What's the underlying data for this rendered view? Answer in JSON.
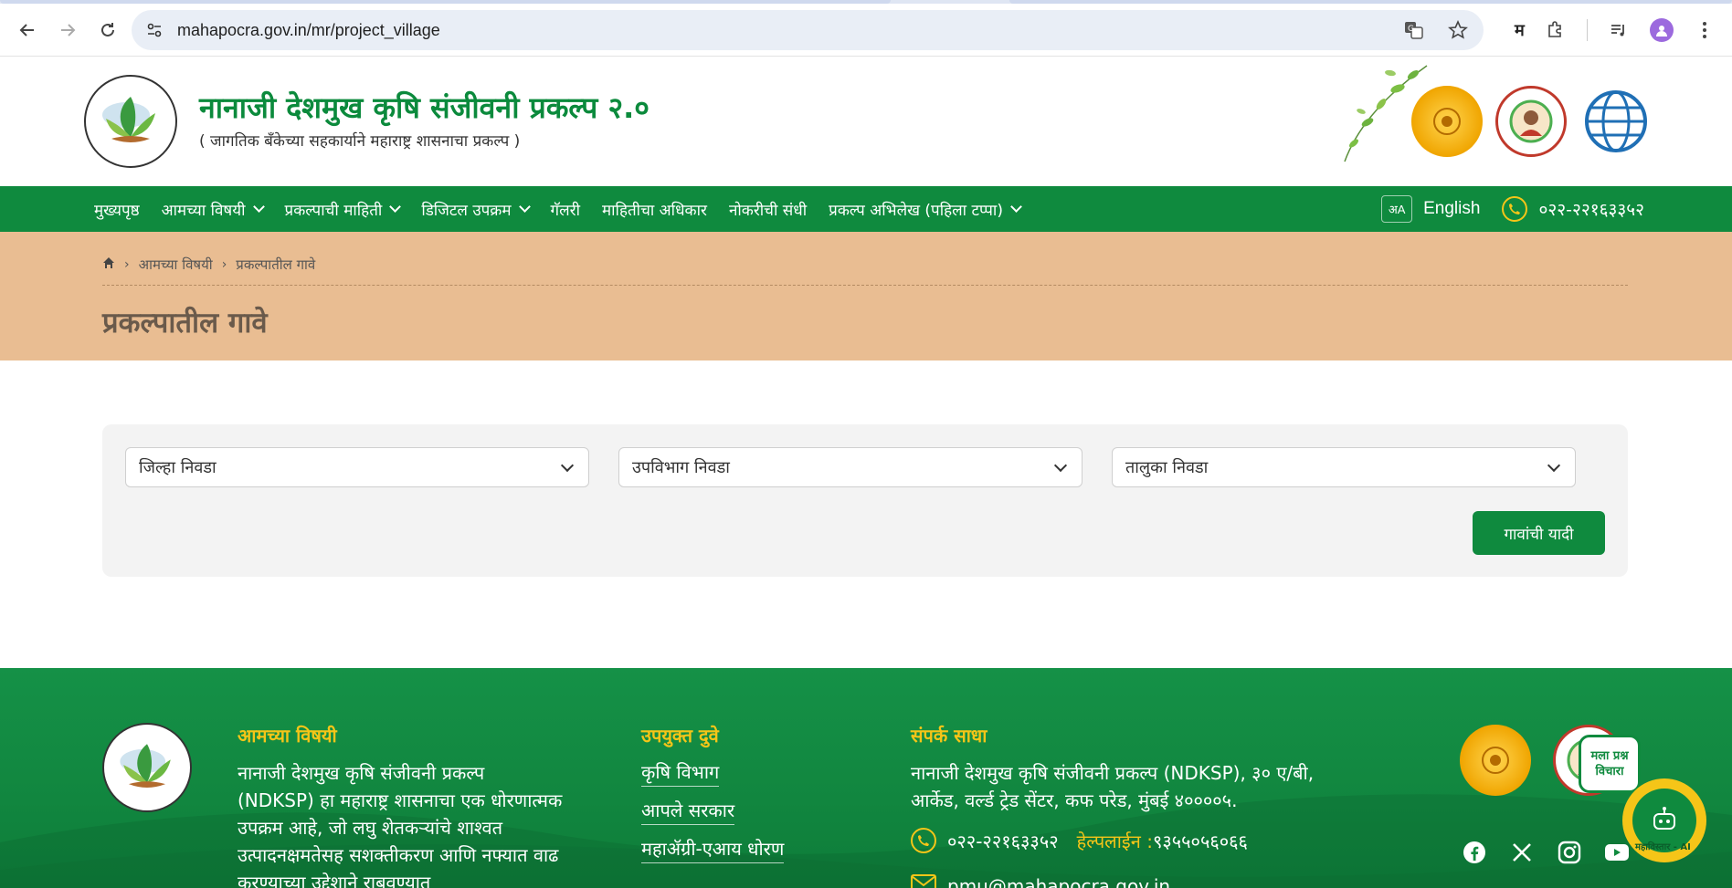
{
  "browser": {
    "url": "mahapocra.gov.in/mr/project_village",
    "profile_letter": "म"
  },
  "header": {
    "title": "नानाजी देशमुख कृषि संजीवनी प्रकल्प २.०",
    "subtitle": "( जागतिक बँकेच्या सहकार्याने महाराष्ट्र शासनाचा प्रकल्प )"
  },
  "nav": {
    "items": [
      {
        "label": "मुख्यपृष्ठ",
        "has_caret": false
      },
      {
        "label": "आमच्या विषयी",
        "has_caret": true
      },
      {
        "label": "प्रकल्पाची माहिती",
        "has_caret": true
      },
      {
        "label": "डिजिटल उपक्रम",
        "has_caret": true
      },
      {
        "label": "गॅलरी",
        "has_caret": false
      },
      {
        "label": "माहितीचा अधिकार",
        "has_caret": false
      },
      {
        "label": "नोकरीची संधी",
        "has_caret": false
      },
      {
        "label": "प्रकल्प अभिलेख (पहिला टप्पा)",
        "has_caret": true
      }
    ],
    "language": "English",
    "phone": "०२२-२२१६३३५२"
  },
  "breadcrumb": {
    "level1": "आमच्या विषयी",
    "level2": "प्रकल्पातील गावे"
  },
  "page": {
    "title": "प्रकल्पातील गावे"
  },
  "filters": {
    "district_placeholder": "जिल्हा निवडा",
    "subdivision_placeholder": "उपविभाग निवडा",
    "taluka_placeholder": "तालुका निवडा",
    "submit_label": "गावांची यादी"
  },
  "footer": {
    "about_title": "आमच्या विषयी",
    "about_text": "नानाजी देशमुख कृषि संजीवनी प्रकल्प (NDKSP) हा महाराष्ट्र शासनाचा एक धोरणात्मक उपक्रम आहे, जो लघु शेतकऱ्यांचे शाश्वत उत्पादनक्षमतेसह सशक्तीकरण आणि नफ्यात वाढ करण्याच्या उद्देशाने राबवण्यात",
    "links_title": "उपयुक्त दुवे",
    "links": [
      "कृषि विभाग",
      "आपले सरकार",
      "महाॲग्री-एआय धोरण"
    ],
    "contact_title": "संपर्क साधा",
    "address": "नानाजी देशमुख कृषि संजीवनी प्रकल्प (NDKSP), ३० ए/बी, आर्केड, वर्ल्ड ट्रेड सेंटर, कफ परेड, मुंबई ४००००५.",
    "phone": "०२२-२२१६३३५२",
    "helpline_label": "हेल्पलाईन :",
    "helpline_number": "९३५५०५६०६६",
    "email": "pmu@mahapocra.gov.in"
  },
  "chat": {
    "bubble_line1": "मला प्रश्न",
    "bubble_line2": "विचारा",
    "caption": "महाविस्तार - AI"
  },
  "colors": {
    "brand_green": "#0f8a3e",
    "accent_yellow": "#f5c518",
    "banner_tan": "#e9bd92"
  }
}
